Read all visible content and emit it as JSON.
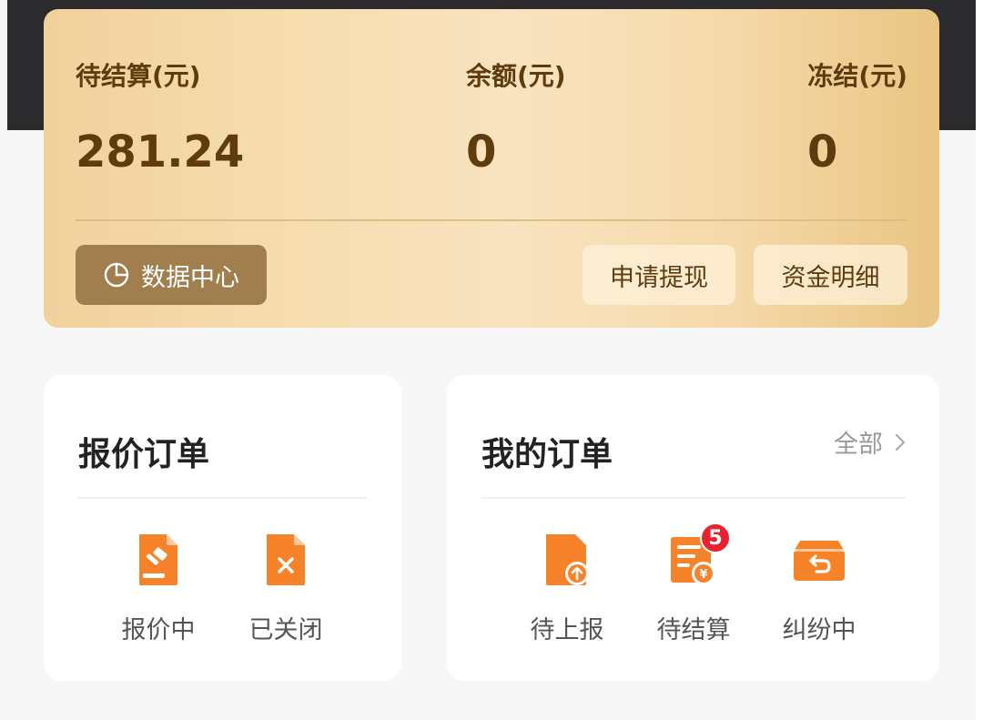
{
  "summary": {
    "pending_label": "待结算(元)",
    "pending_value": "281.24",
    "balance_label": "余额(元)",
    "balance_value": "0",
    "frozen_label": "冻结(元)",
    "frozen_value": "0"
  },
  "actions": {
    "data_center": "数据中心",
    "withdraw": "申请提现",
    "fund_detail": "资金明细"
  },
  "quote_orders": {
    "title": "报价订单",
    "items": [
      {
        "label": "报价中",
        "icon": "auction-document-icon"
      },
      {
        "label": "已关闭",
        "icon": "closed-document-icon"
      }
    ]
  },
  "my_orders": {
    "title": "我的订单",
    "all_label": "全部",
    "items": [
      {
        "label": "待上报",
        "icon": "upload-document-icon"
      },
      {
        "label": "待结算",
        "icon": "settlement-document-icon",
        "badge": "5"
      },
      {
        "label": "纠纷中",
        "icon": "dispute-return-icon"
      }
    ]
  },
  "colors": {
    "accent": "#f6832a",
    "gold_text": "#5e3c0e",
    "badge": "#e8232f"
  }
}
